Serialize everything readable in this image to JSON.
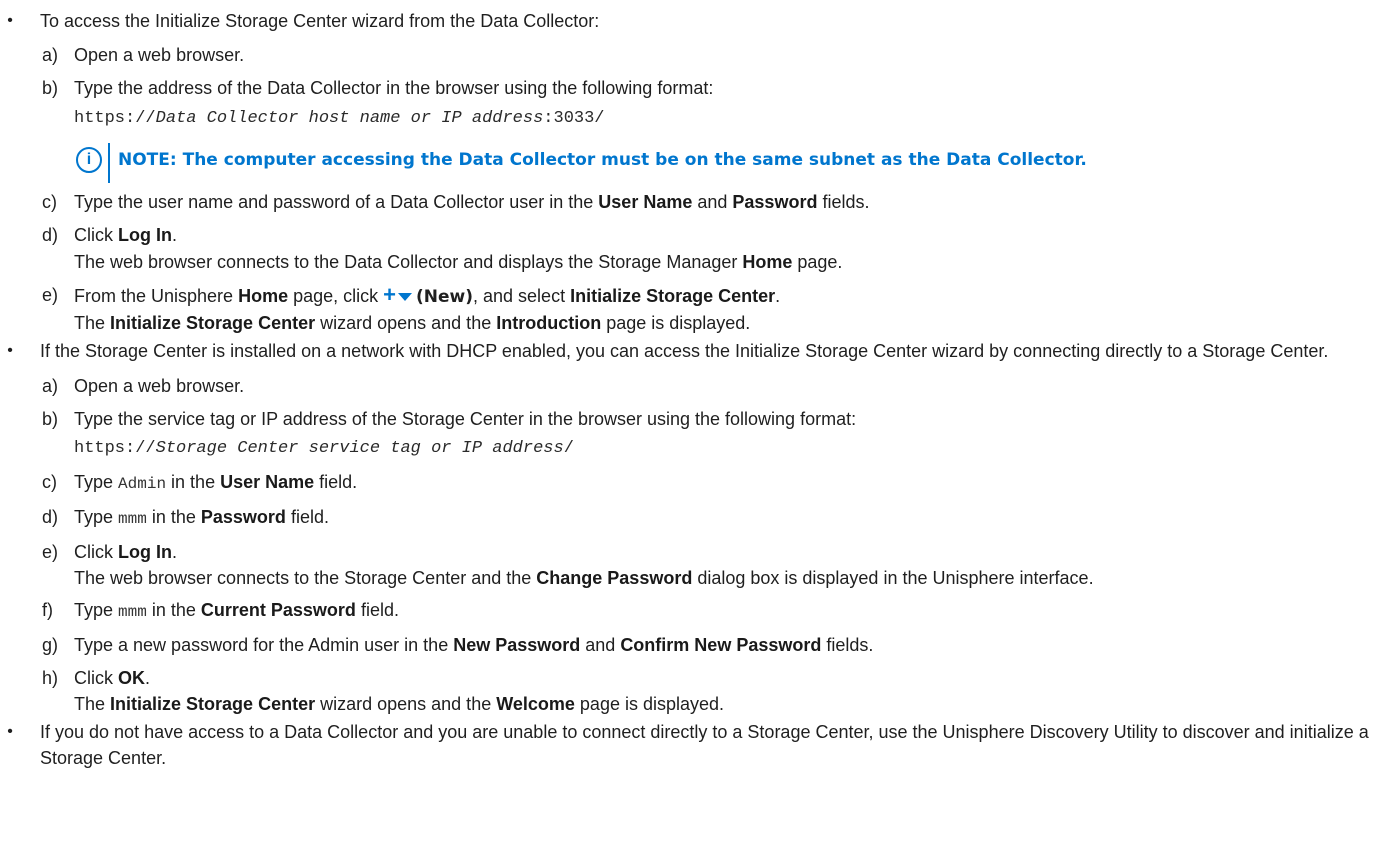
{
  "bullets": [
    {
      "intro": "To access the Initialize Storage Center wizard from the Data Collector:",
      "steps": {
        "a": {
          "marker": "a)",
          "text": "Open a web browser."
        },
        "b": {
          "marker": "b)",
          "text": "Type the address of the Data Collector in the browser using the following format:",
          "code_prefix": "https://",
          "code_var": "Data Collector host name or IP address",
          "code_suffix": ":3033/"
        },
        "note": {
          "label": "NOTE:",
          "text": "The computer accessing the Data Collector must be on the same subnet as the Data Collector."
        },
        "c": {
          "marker": "c)",
          "pre": "Type the user name and password of a Data Collector user in the ",
          "b1": "User Name",
          "mid": " and ",
          "b2": "Password",
          "post": " fields."
        },
        "d": {
          "marker": "d)",
          "pre": "Click ",
          "b1": "Log In",
          "post": ".",
          "result_pre": "The web browser connects to the Data Collector and displays the Storage Manager ",
          "result_b": "Home",
          "result_post": " page."
        },
        "e": {
          "marker": "e)",
          "pre": "From the Unisphere ",
          "b1": "Home",
          "mid": " page, click ",
          "new_label": "(New)",
          "mid2": ", and select ",
          "b2": "Initialize Storage Center",
          "post": ".",
          "result_b1": "Initialize Storage Center",
          "result_mid": " wizard opens and the ",
          "result_b2": "Introduction",
          "result_post": " page is displayed.",
          "result_the": "The "
        }
      }
    },
    {
      "intro": "If the Storage Center is installed on a network with DHCP enabled, you can access the Initialize Storage Center wizard by connecting directly to a Storage Center.",
      "steps": {
        "a": {
          "marker": "a)",
          "text": "Open a web browser."
        },
        "b": {
          "marker": "b)",
          "text": "Type the service tag or IP address of the Storage Center in the browser using the following format:",
          "code_prefix": "https://",
          "code_var": "Storage Center service tag or IP address",
          "code_suffix": "/"
        },
        "c": {
          "marker": "c)",
          "pre": "Type ",
          "code": "Admin",
          "mid": " in the ",
          "b1": "User Name",
          "post": " field."
        },
        "d": {
          "marker": "d)",
          "pre": "Type ",
          "code": "mmm",
          "mid": " in the ",
          "b1": "Password",
          "post": " field."
        },
        "e": {
          "marker": "e)",
          "pre": "Click ",
          "b1": "Log In",
          "post": ".",
          "result_pre": "The web browser connects to the Storage Center and the ",
          "result_b": "Change Password",
          "result_post": " dialog box is displayed in the Unisphere interface."
        },
        "f": {
          "marker": "f)",
          "pre": "Type ",
          "code": "mmm",
          "mid": " in the ",
          "b1": "Current Password",
          "post": " field."
        },
        "g": {
          "marker": "g)",
          "pre": "Type a new password for the Admin user in the ",
          "b1": "New Password",
          "mid": " and ",
          "b2": "Confirm New Password",
          "post": " fields."
        },
        "h": {
          "marker": "h)",
          "pre": "Click ",
          "b1": "OK",
          "post": ".",
          "result_the": "The ",
          "result_b1": "Initialize Storage Center",
          "result_mid": " wizard opens and the ",
          "result_b2": "Welcome",
          "result_post": " page is displayed."
        }
      }
    },
    {
      "intro": "If you do not have access to a Data Collector and you are unable to connect directly to a Storage Center, use the Unisphere Discovery Utility to discover and initialize a Storage Center."
    }
  ],
  "bullet_symbol": "•",
  "icons": {
    "note": "info-circle-icon",
    "new": "plus-icon",
    "dropdown": "caret-down-icon"
  },
  "colors": {
    "accent": "#0076ce",
    "text": "#1f1f1f"
  }
}
